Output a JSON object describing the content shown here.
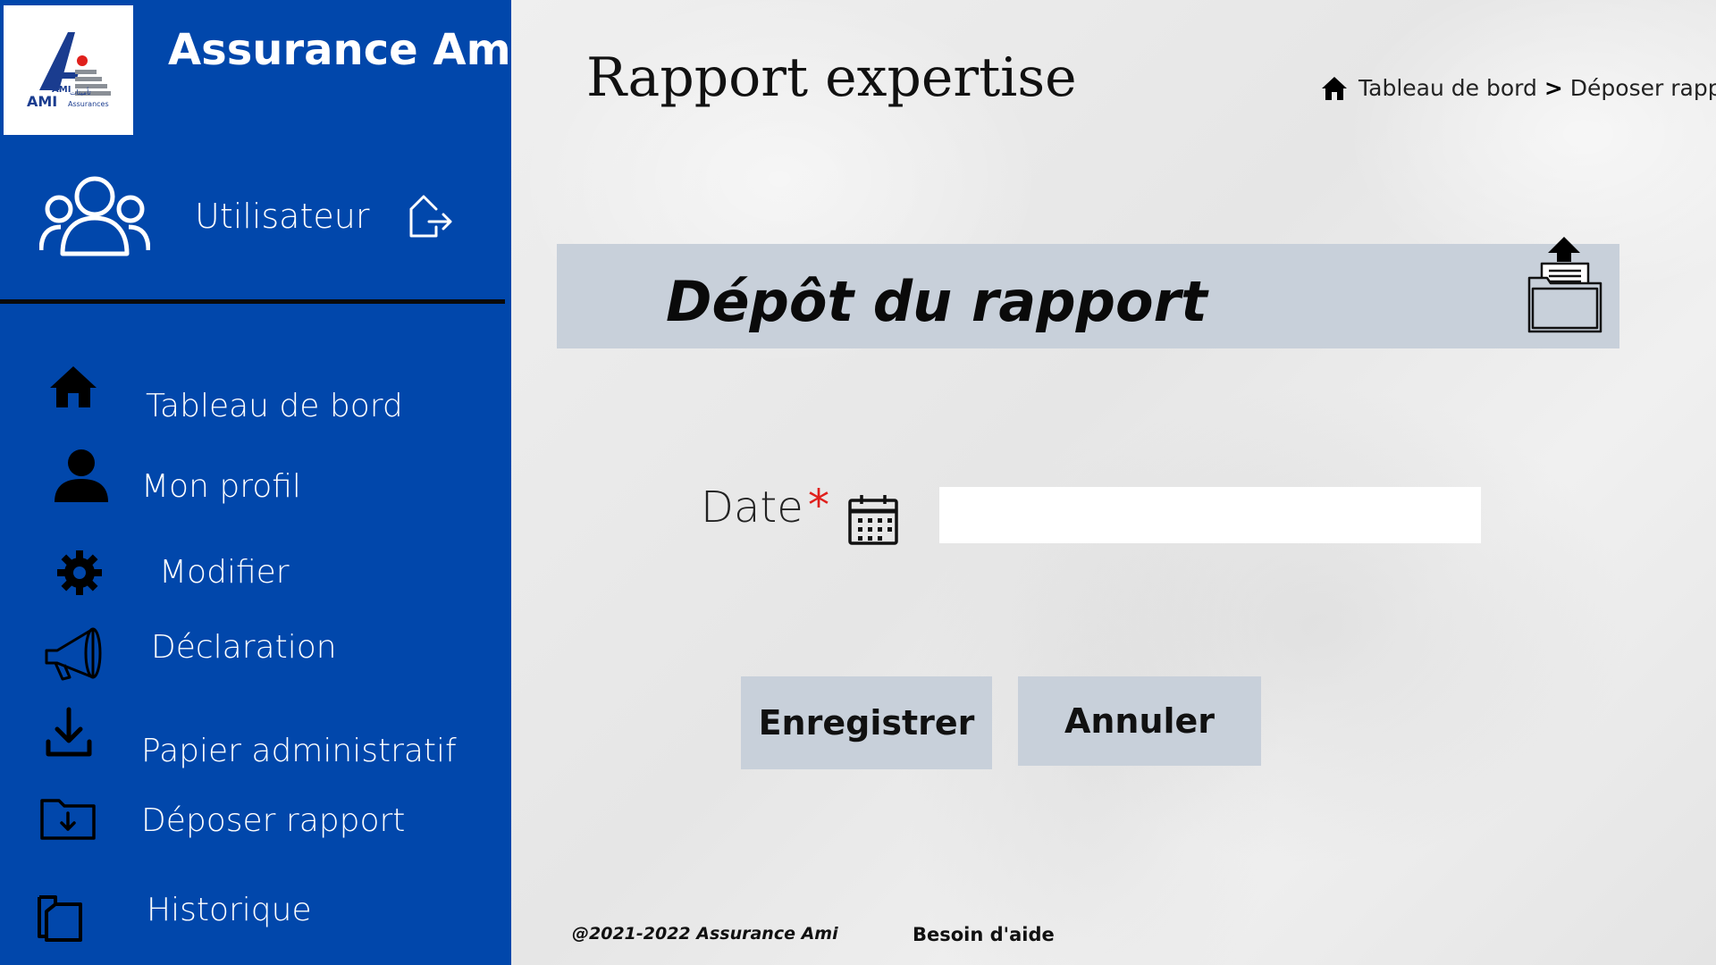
{
  "app": {
    "brand_name": "Assurance Ami",
    "logo_text_top": "AMI",
    "logo_text_main": "AMI",
    "logo_text_sub": "Assurances",
    "logo_text_ar": "تأمينات"
  },
  "user": {
    "label": "Utilisateur"
  },
  "sidebar": {
    "items": [
      {
        "label": "Tableau de bord",
        "icon": "home-icon"
      },
      {
        "label": "Mon profil",
        "icon": "person-icon"
      },
      {
        "label": "Modifier",
        "icon": "gear-icon"
      },
      {
        "label": "Déclaration",
        "icon": "megaphone-icon"
      },
      {
        "label": "Papier administratif",
        "icon": "download-icon"
      },
      {
        "label": "Déposer rapport",
        "icon": "folder-upload-icon"
      },
      {
        "label": "Historique",
        "icon": "documents-icon"
      }
    ]
  },
  "header": {
    "title": "Rapport expertise",
    "breadcrumb": {
      "home": "Tableau de bord",
      "separator": ">",
      "current": "Déposer rapport"
    }
  },
  "panel": {
    "title": "Dépôt du rapport"
  },
  "form": {
    "date_label": "Date",
    "required_mark": "*",
    "date_value": "",
    "save_label": "Enregistrer",
    "cancel_label": "Annuler"
  },
  "footer": {
    "copyright": "@2021-2022 Assurance Ami",
    "help": "Besoin d'aide"
  },
  "colors": {
    "sidebar_bg": "#0147ab",
    "panel_bg": "#c8d0da",
    "required": "#e0201c"
  }
}
